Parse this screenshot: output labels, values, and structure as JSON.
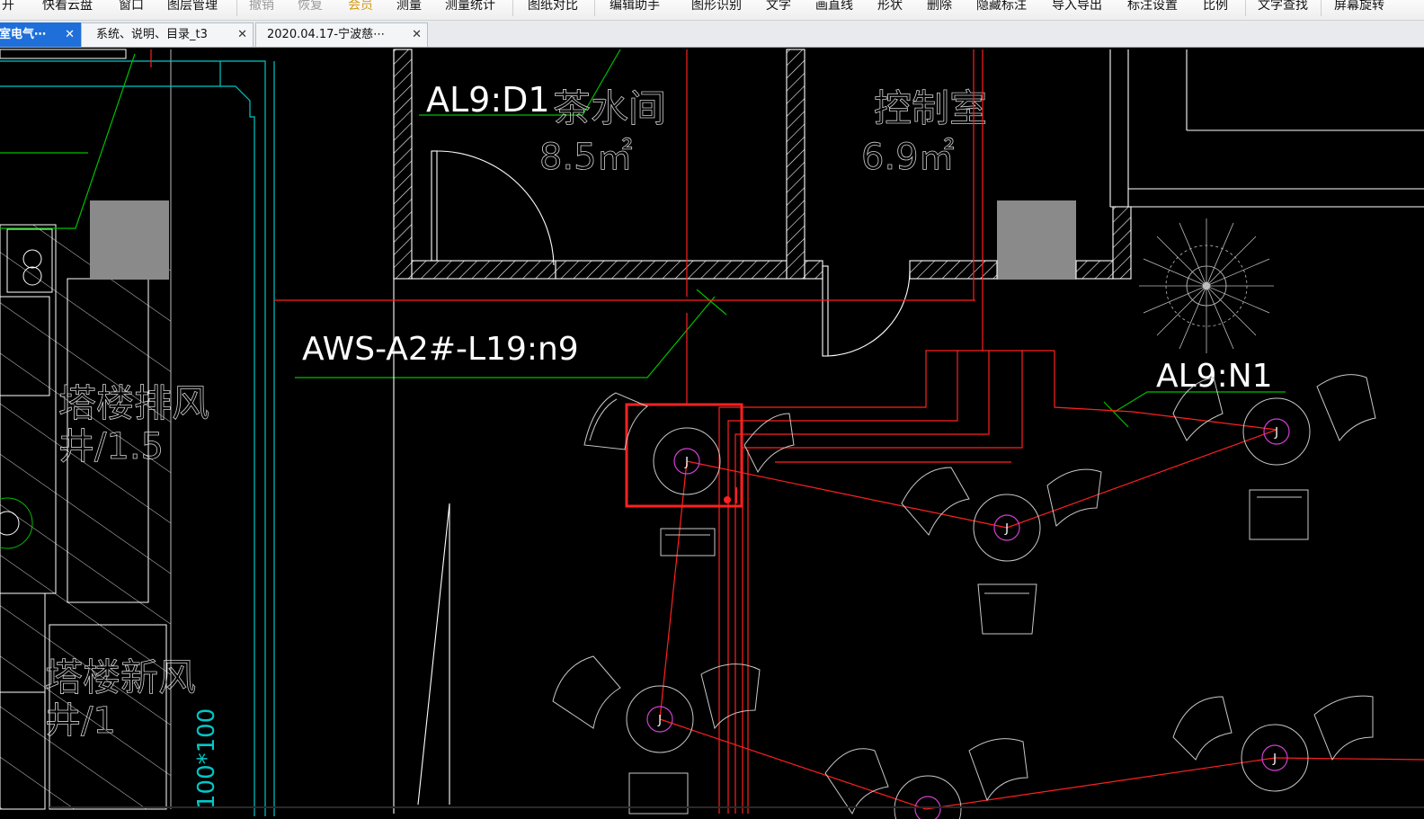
{
  "toolbar": {
    "items": [
      {
        "label": "打开",
        "state": "normal"
      },
      {
        "label": "快看云盘",
        "state": "normal"
      },
      {
        "label": "窗口",
        "state": "normal"
      },
      {
        "label": "图层管理",
        "state": "normal"
      },
      {
        "label": "撤销",
        "state": "disabled"
      },
      {
        "label": "恢复",
        "state": "disabled"
      },
      {
        "label": "会员",
        "state": "highlight"
      },
      {
        "label": "测量",
        "state": "normal"
      },
      {
        "label": "测量统计",
        "state": "normal"
      },
      {
        "label": "图纸对比",
        "state": "normal"
      },
      {
        "label": "编辑助手",
        "state": "normal"
      },
      {
        "label": "图形识别",
        "state": "normal"
      },
      {
        "label": "文字",
        "state": "normal"
      },
      {
        "label": "画直线",
        "state": "normal"
      },
      {
        "label": "形状",
        "state": "normal"
      },
      {
        "label": "删除",
        "state": "normal"
      },
      {
        "label": "隐藏标注",
        "state": "normal"
      },
      {
        "label": "导入导出",
        "state": "normal"
      },
      {
        "label": "标注设置",
        "state": "normal"
      },
      {
        "label": "比例",
        "state": "normal"
      },
      {
        "label": "文字查找",
        "state": "normal"
      },
      {
        "label": "屏幕旋转",
        "state": "normal"
      }
    ]
  },
  "tabs": [
    {
      "label": "室电气⋯",
      "active": true,
      "close": "✕"
    },
    {
      "label": "系统、说明、目录_t3",
      "active": false,
      "close": "✕"
    },
    {
      "label": "2020.04.17-宁波慈⋯",
      "active": false,
      "close": "✕"
    }
  ],
  "drawing": {
    "room_tea": {
      "name": "茶水间",
      "area": "8.5㎡"
    },
    "room_control": {
      "name": "控制室",
      "area": "6.9㎡"
    },
    "label_al9_d1": "AL9:D1",
    "label_al9_n1": "AL9:N1",
    "label_aws": "AWS-A2#-L19:n9",
    "shaft_exhaust": {
      "line1": "塔楼排风",
      "line2": "井/1.5"
    },
    "shaft_fresh": {
      "line1": "塔楼新风",
      "line2": "井/1"
    },
    "duct_size": "100*100",
    "junction_label": "J",
    "colors": {
      "background": "#000000",
      "wall": "#ffffff",
      "circuit": "#ff2020",
      "leader": "#00c000",
      "junction": "#d040d0",
      "duct": "#00c8c8",
      "column": "#8a8a8a",
      "furniture": "#c8c8c8",
      "selection": "#ff2020"
    }
  }
}
